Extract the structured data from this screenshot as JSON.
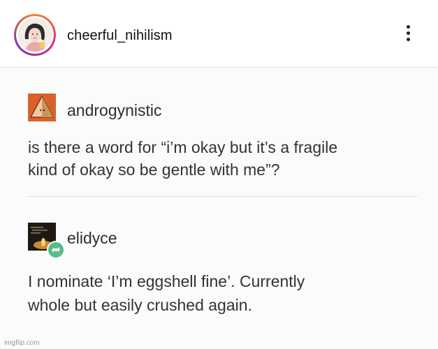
{
  "header": {
    "username": "cheerful_nihilism",
    "avatar_icon": "profile-photo-icon",
    "menu_icon": "more-vertical-icon"
  },
  "post": {
    "first": {
      "username": "androgynistic",
      "text_line1": "is there a word for “i’m okay but it’s a fragile",
      "text_line2": "kind of okay so be gentle with me”?"
    },
    "second": {
      "username": "elidyce",
      "text_line1": "I nominate ‘I’m eggshell fine’. Currently",
      "text_line2": "whole but easily crushed again."
    }
  },
  "watermark": "imgflip.com",
  "colors": {
    "ring_start": "#f58529",
    "ring_mid": "#dd2a7b",
    "ring_end": "#8134af",
    "reblog_green": "#56bc8a"
  }
}
